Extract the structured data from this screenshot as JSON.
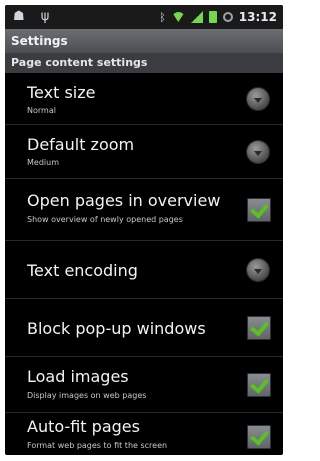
{
  "status_bar": {
    "time": "13:12"
  },
  "title_bar": {
    "title": "Settings"
  },
  "section_header": {
    "label": "Page content settings"
  },
  "settings": [
    {
      "title": "Text size",
      "subtitle": "Normal",
      "control": "spinner"
    },
    {
      "title": "Default zoom",
      "subtitle": "Medium",
      "control": "spinner"
    },
    {
      "title": "Open pages in overview",
      "subtitle": "Show overview of newly opened pages",
      "control": "checkbox",
      "checked": true
    },
    {
      "title": "Text encoding",
      "subtitle": "",
      "control": "spinner"
    },
    {
      "title": "Block pop-up windows",
      "subtitle": "",
      "control": "checkbox",
      "checked": true
    },
    {
      "title": "Load images",
      "subtitle": "Display images on web pages",
      "control": "checkbox",
      "checked": true
    },
    {
      "title": "Auto-fit pages",
      "subtitle": "Format web pages to fit the screen",
      "control": "checkbox",
      "checked": true
    }
  ],
  "colors": {
    "checkmark": "#5ac21f",
    "signal": "#73d84c",
    "background": "#000000"
  }
}
